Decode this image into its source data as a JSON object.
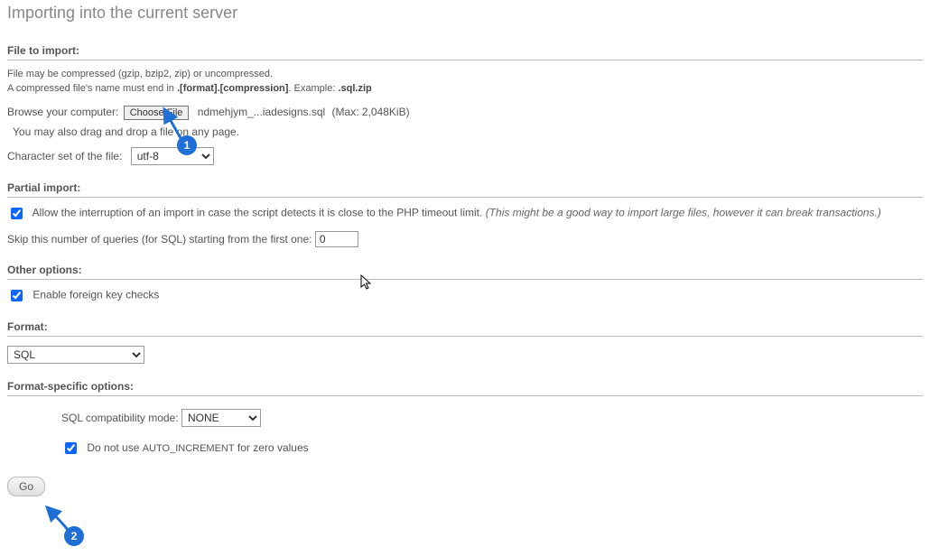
{
  "page": {
    "title": "Importing into the current server"
  },
  "fileImport": {
    "heading": "File to import:",
    "compressNote": "File may be compressed (gzip, bzip2, zip) or uncompressed.",
    "compressNote2a": "A compressed file's name must end in ",
    "compressNote2b": ".[format].[compression]",
    "compressNote2c": ". Example: ",
    "compressNote2d": ".sql.zip",
    "browseLabel": "Browse your computer:",
    "chooseFile": "Choose File",
    "filename": "ndmehjym_...iadesigns.sql",
    "maxSize": "(Max: 2,048KiB)",
    "dragDropNote": "You may also drag and drop a file on any page.",
    "charsetLabel": "Character set of the file:",
    "charset": "utf-8"
  },
  "partialImport": {
    "heading": "Partial import:",
    "allowInterruptLabel": "Allow the interruption of an import in case the script detects it is close to the PHP timeout limit. ",
    "allowInterruptHint": "(This might be a good way to import large files, however it can break transactions.)",
    "skipLabel": "Skip this number of queries (for SQL) starting from the first one:",
    "skipValue": "0"
  },
  "otherOptions": {
    "heading": "Other options:",
    "foreignKeyLabel": "Enable foreign key checks"
  },
  "format": {
    "heading": "Format:",
    "value": "SQL"
  },
  "formatSpecific": {
    "heading": "Format-specific options:",
    "sqlModeLabel": "SQL compatibility mode:",
    "sqlModeValue": "NONE",
    "noAutoIncPrefix": "Do not use ",
    "noAutoIncCode": "AUTO_INCREMENT",
    "noAutoIncSuffix": " for zero values"
  },
  "actions": {
    "go": "Go"
  },
  "markers": {
    "m1": "1",
    "m2": "2"
  }
}
